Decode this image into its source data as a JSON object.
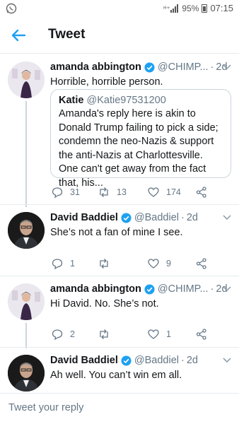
{
  "status_bar": {
    "battery": "95%",
    "time": "07:15"
  },
  "header": {
    "title": "Tweet"
  },
  "tweets": [
    {
      "name": "amanda abbington",
      "handle": "@CHIMP...",
      "time": "2d",
      "text": "Horrible, horrible person.",
      "quote": {
        "name": "Katie",
        "handle": "@Katie97531200",
        "text": "Amanda's reply here is akin to Donald Trump failing to pick a side; condemn the neo-Nazis & support the anti-Nazis at Charlottesville.  One can't get away from the fact that, his..."
      },
      "replies": "31",
      "retweets": "13",
      "likes": "174"
    },
    {
      "name": "David Baddiel",
      "handle": "@Baddiel",
      "time": "2d",
      "text": "She’s not a fan of mine I see.",
      "replies": "1",
      "retweets": "",
      "likes": "9"
    },
    {
      "name": "amanda abbington",
      "handle": "@CHIMP...",
      "time": "2d",
      "text": "Hi David. No. She’s not.",
      "replies": "2",
      "retweets": "",
      "likes": "1"
    },
    {
      "name": "David Baddiel",
      "handle": "@Baddiel",
      "time": "2d",
      "text": "Ah well. You can’t win em all."
    }
  ],
  "reply_bar": {
    "placeholder": "Tweet your reply"
  },
  "colors": {
    "accent": "#1da1f2",
    "muted": "#657786",
    "border": "#e6ecf0"
  }
}
